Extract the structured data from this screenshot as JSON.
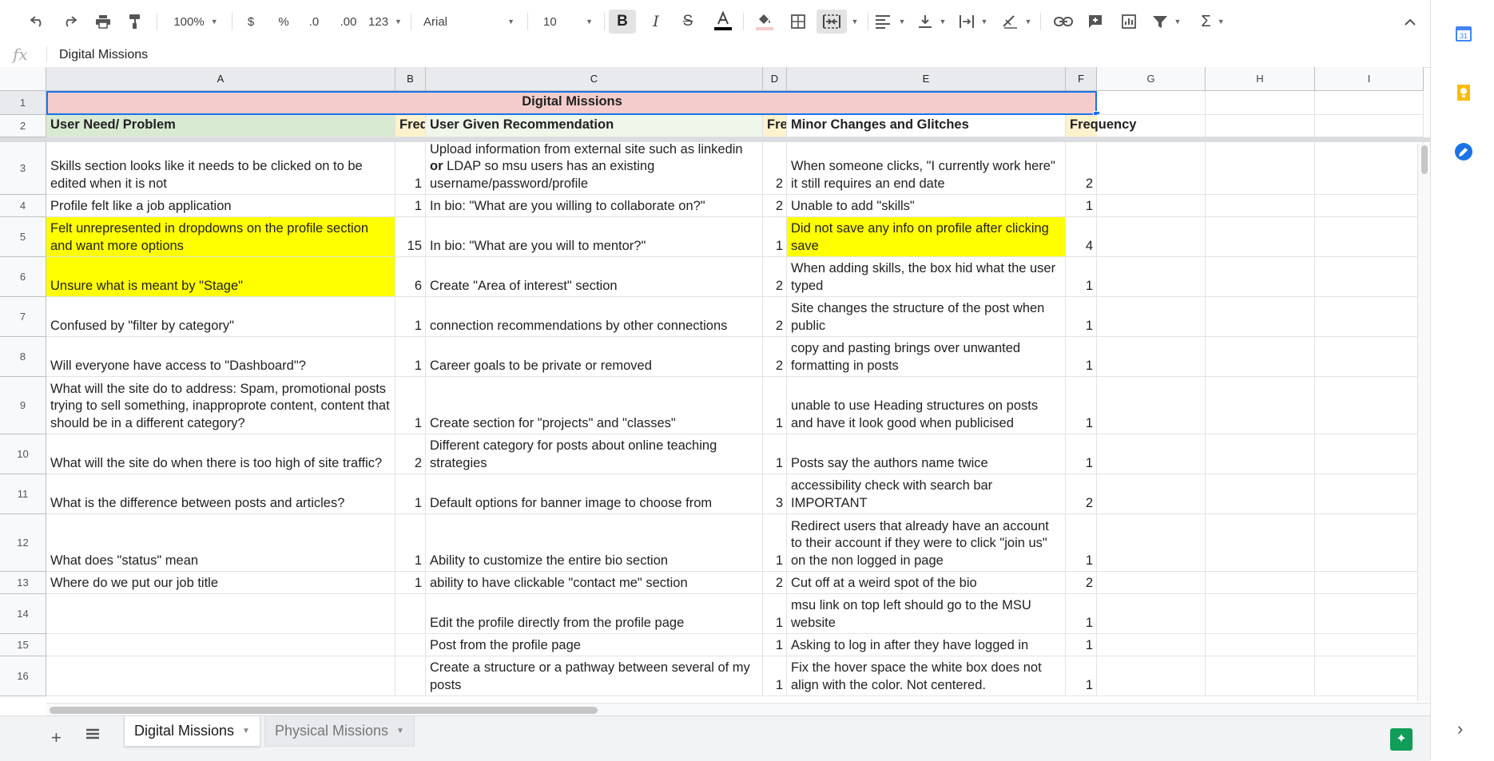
{
  "toolbar": {
    "zoom": "100%",
    "currency": "$",
    "percent": "%",
    "dec_less": ".0",
    "dec_more": ".00",
    "format": "123",
    "font": "Arial",
    "font_size": "10"
  },
  "formula_bar": {
    "fx": "fx",
    "value": "Digital Missions"
  },
  "columns": [
    "A",
    "B",
    "C",
    "D",
    "E",
    "F",
    "G",
    "H",
    "I"
  ],
  "rows": [
    {
      "n": "1"
    },
    {
      "n": "2"
    },
    {
      "n": "3"
    },
    {
      "n": "4"
    },
    {
      "n": "5"
    },
    {
      "n": "6"
    },
    {
      "n": "7"
    },
    {
      "n": "8"
    },
    {
      "n": "9"
    },
    {
      "n": "10"
    },
    {
      "n": "11"
    },
    {
      "n": "12"
    },
    {
      "n": "13"
    },
    {
      "n": "14"
    },
    {
      "n": "15"
    },
    {
      "n": "16"
    }
  ],
  "title": "Digital Missions",
  "headers": {
    "a": "User Need/ Problem",
    "b": "Freq",
    "c": "User Given Recommendation",
    "d": "Fre",
    "e": "Minor Changes and Glitches",
    "f": "Frequency"
  },
  "data": [
    {
      "a": "Skills section looks like it needs to be clicked on to be edited when it is not",
      "b": "1",
      "c": "",
      "d": "2",
      "e": "When someone clicks, \"I currently work here\" it still requires an end date",
      "f": "2"
    },
    {
      "a": "Profile felt like a job application",
      "b": "1",
      "c": "In bio: \"What are you willing to collaborate on?\"",
      "d": "2",
      "e": "Unable to add \"skills\"",
      "f": "1"
    },
    {
      "a": "Felt unrepresented in dropdowns on the profile section and want more options",
      "b": "15",
      "c": "In bio: \"What are you will to mentor?\"",
      "d": "1",
      "e": "Did not save any info on profile after clicking save",
      "f": "4"
    },
    {
      "a": "Unsure what is meant by \"Stage\"",
      "b": "6",
      "c": "Create \"Area of interest\" section",
      "d": "2",
      "e": "When adding skills, the box hid what the user typed",
      "f": "1"
    },
    {
      "a": "Confused by \"filter by category\"",
      "b": "1",
      "c": "connection recommendations by other connections",
      "d": "2",
      "e": "Site changes the structure of the post when public",
      "f": "1"
    },
    {
      "a": "Will everyone have access to \"Dashboard\"?",
      "b": "1",
      "c": "Career goals to be private or removed",
      "d": "2",
      "e": "copy and pasting brings over unwanted formatting in posts",
      "f": "1"
    },
    {
      "a": "What will the site do to address: Spam, promotional posts trying to sell something, inapproprote content, content that should be in a different category?",
      "b": "1",
      "c": "Create section for \"projects\" and \"classes\"",
      "d": "1",
      "e": "unable to use Heading structures on posts and have it look good when publicised",
      "f": "1"
    },
    {
      "a": "What will the site do when there is too high of site traffic?",
      "b": "2",
      "c": "Different category for posts about online teaching strategies",
      "d": "1",
      "e": "Posts say the authors name twice",
      "f": "1"
    },
    {
      "a": "What is the difference between posts and articles?",
      "b": "1",
      "c": "Default options for banner image to choose from",
      "d": "3",
      "e": "accessibility check with search bar IMPORTANT",
      "f": "2"
    },
    {
      "a": "What does \"status\" mean",
      "b": "1",
      "c": "Ability to customize the entire bio section",
      "d": "1",
      "e": "Redirect users that already have an account to their account if they were to click \"join us\" on the non logged in page",
      "f": "1"
    },
    {
      "a": "Where do we put our job title",
      "b": "1",
      "c": "ability to have clickable \"contact me\" section",
      "d": "2",
      "e": "Cut off at a weird spot of the bio",
      "f": "2"
    },
    {
      "a": "",
      "b": "",
      "c": "Edit the profile directly from the profile page",
      "d": "1",
      "e": "msu link on top left should go to the MSU website",
      "f": "1"
    },
    {
      "a": "",
      "b": "",
      "c": "Post from the profile page",
      "d": "1",
      "e": "Asking to log in after they have logged in",
      "f": "1"
    },
    {
      "a": "",
      "b": "",
      "c": "Create a structure or a pathway between several of my posts",
      "d": "1",
      "e": "Fix the hover space the white box does not align with the color. Not centered.",
      "f": "1"
    }
  ],
  "row3_c": {
    "part1": "Upload information from external site such as linkedin ",
    "bold": "or",
    "part2": " LDAP so msu users has an existing username/password/profile"
  },
  "colors": {
    "title_bg": "#f4cccc",
    "header_a_bg": "#d9ead3",
    "header_b_bg": "#fff2cc",
    "header_c_bg": "#eef7ea",
    "highlight": "#ffff00",
    "selection": "#1a73e8"
  },
  "tabs": [
    {
      "label": "Digital Missions",
      "active": true
    },
    {
      "label": "Physical Missions",
      "active": false
    }
  ]
}
